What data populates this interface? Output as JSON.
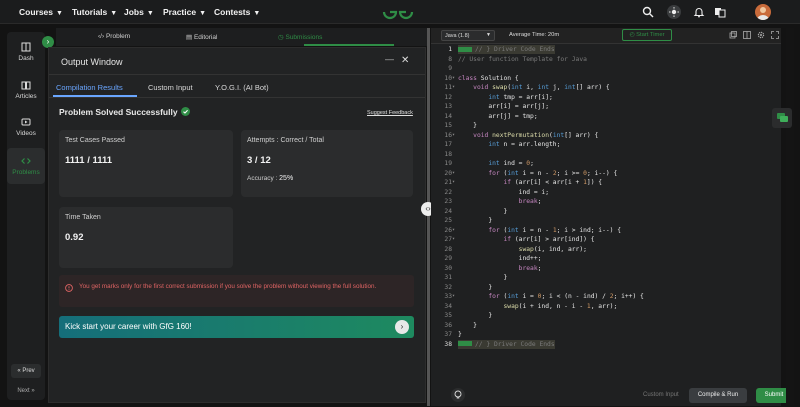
{
  "nav": {
    "items": [
      {
        "label": "Courses",
        "name": "nav-courses"
      },
      {
        "label": "Tutorials",
        "name": "nav-tutorials"
      },
      {
        "label": "Jobs",
        "name": "nav-jobs"
      },
      {
        "label": "Practice",
        "name": "nav-practice"
      },
      {
        "label": "Contests",
        "name": "nav-contests"
      }
    ],
    "brand_color": "#2f8d46"
  },
  "rail": {
    "items": [
      {
        "label": "Dash",
        "icon": "dashboard-icon"
      },
      {
        "label": "Articles",
        "icon": "book-icon"
      },
      {
        "label": "Videos",
        "icon": "video-icon"
      },
      {
        "label": "Problems",
        "icon": "code-icon"
      }
    ],
    "prev": "« Prev",
    "next": "Next »"
  },
  "problem_tabs": {
    "problem": "Problem",
    "editorial": "Editorial",
    "submissions": "Submissions"
  },
  "output_window": {
    "title": "Output Window",
    "tabs": [
      "Compilation Results",
      "Custom Input",
      "Y.O.G.I. (AI Bot)"
    ],
    "status": "Problem Solved Successfully",
    "suggest_feedback": "Suggest Feedback",
    "cards": {
      "test_cases_label": "Test Cases Passed",
      "test_cases_value": "1111 / 1111",
      "attempts_label": "Attempts : Correct / Total",
      "attempts_value": "3 / 12",
      "accuracy_label": "Accuracy :",
      "accuracy_value": "25%",
      "time_label": "Time Taken",
      "time_value": "0.92"
    },
    "warning": "You get marks only for the first correct submission if you solve the problem without viewing the full solution.",
    "banner": "Kick start your career with GfG 160!"
  },
  "editor": {
    "language": "Java (1.8)",
    "average_time": "Average Time: 20m",
    "start_timer": "Start Timer",
    "custom_input": "Custom Input",
    "compile_run": "Compile & Run",
    "submit": "Submit",
    "lines": [
      {
        "n": "1",
        "html": "<span class=\"cm\">// } Driver Code Ends</span>",
        "hl": true,
        "active": true
      },
      {
        "n": "8",
        "html": "<span class=\"cm\">// User function Template for Java</span>"
      },
      {
        "n": "9",
        "html": ""
      },
      {
        "n": "10",
        "html": "<span class=\"kw\">class</span> Solution {"
      },
      {
        "n": "11",
        "html": "    <span class=\"kw\">void</span> <span class=\"fn\">swap</span>(<span class=\"ty\">int</span> i, <span class=\"ty\">int</span> j, <span class=\"ty\">int</span>[] arr) {"
      },
      {
        "n": "12",
        "html": "        <span class=\"ty\">int</span> tmp = arr[i];"
      },
      {
        "n": "13",
        "html": "        arr[i] = arr[j];"
      },
      {
        "n": "14",
        "html": "        arr[j] = tmp;"
      },
      {
        "n": "15",
        "html": "    }"
      },
      {
        "n": "16",
        "html": "    <span class=\"kw\">void</span> <span class=\"fn\">nextPermutation</span>(<span class=\"ty\">int</span>[] arr) {"
      },
      {
        "n": "17",
        "html": "        <span class=\"ty\">int</span> n = arr.length;"
      },
      {
        "n": "18",
        "html": ""
      },
      {
        "n": "19",
        "html": "        <span class=\"ty\">int</span> ind = <span class=\"num\">0</span>;"
      },
      {
        "n": "20",
        "html": "        <span class=\"kw\">for</span> (<span class=\"ty\">int</span> i = n - <span class=\"num\">2</span>; i >= <span class=\"num\">0</span>; i--) {"
      },
      {
        "n": "21",
        "html": "            <span class=\"kw\">if</span> (arr[i] < arr[i + <span class=\"num\">1</span>]) {"
      },
      {
        "n": "22",
        "html": "                ind = i;"
      },
      {
        "n": "23",
        "html": "                <span class=\"kw\">break</span>;"
      },
      {
        "n": "24",
        "html": "            }"
      },
      {
        "n": "25",
        "html": "        }"
      },
      {
        "n": "26",
        "html": "        <span class=\"kw\">for</span> (<span class=\"ty\">int</span> i = n - <span class=\"num\">1</span>; i > ind; i--) {"
      },
      {
        "n": "27",
        "html": "            <span class=\"kw\">if</span> (arr[i] > arr[ind]) {"
      },
      {
        "n": "28",
        "html": "                <span class=\"fn\">swap</span>(i, ind, arr);"
      },
      {
        "n": "29",
        "html": "                ind++;"
      },
      {
        "n": "30",
        "html": "                <span class=\"kw\">break</span>;"
      },
      {
        "n": "31",
        "html": "            }"
      },
      {
        "n": "32",
        "html": "        }"
      },
      {
        "n": "33",
        "html": "        <span class=\"kw\">for</span> (<span class=\"ty\">int</span> i = <span class=\"num\">0</span>; i < (n - ind) / <span class=\"num\">2</span>; i++) {"
      },
      {
        "n": "34",
        "html": "            <span class=\"fn\">swap</span>(i + ind, n - i - <span class=\"num\">1</span>, arr);"
      },
      {
        "n": "35",
        "html": "        }"
      },
      {
        "n": "36",
        "html": "    }"
      },
      {
        "n": "37",
        "html": "}"
      },
      {
        "n": "38",
        "html": "<span class=\"cm\">// } Driver Code Ends</span>",
        "hl": true,
        "active": true
      }
    ]
  }
}
